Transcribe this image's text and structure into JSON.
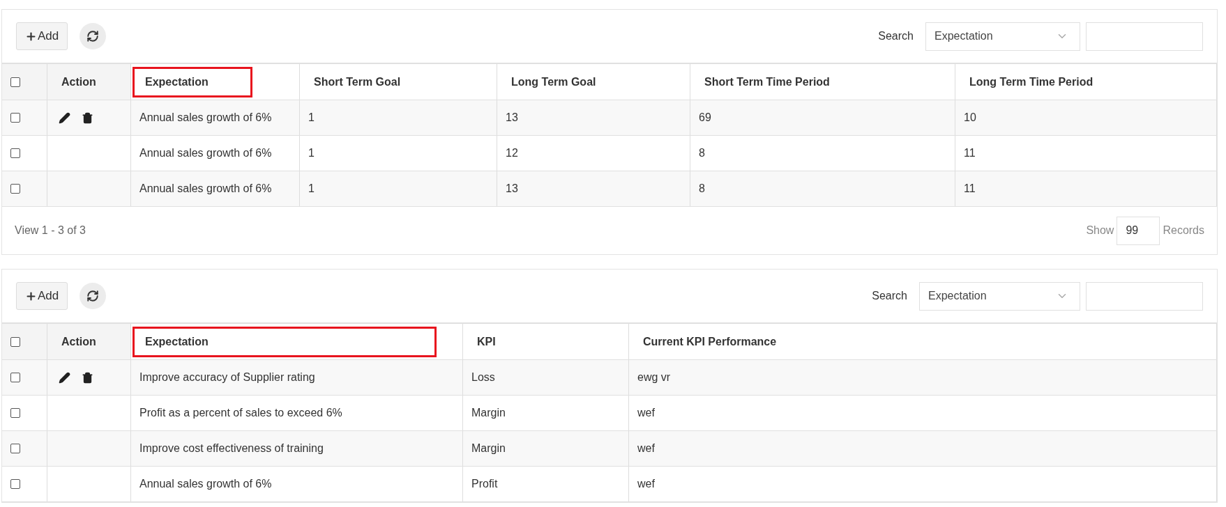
{
  "tables": [
    {
      "toolbar": {
        "add_label": "Add",
        "search_label": "Search",
        "search_field": "Expectation"
      },
      "select_all_checked": false,
      "action_label": "Action",
      "columns": [
        {
          "label": "Expectation",
          "highlighted": true
        },
        {
          "label": "Short Term Goal",
          "highlighted": false
        },
        {
          "label": "Long Term Goal",
          "highlighted": false
        },
        {
          "label": "Short Term Time Period",
          "highlighted": false
        },
        {
          "label": "Long Term Time Period",
          "highlighted": false
        }
      ],
      "rows": [
        {
          "checked": false,
          "actions": true,
          "cells": [
            "Annual sales growth of 6%",
            "1",
            "13",
            "69",
            "10"
          ]
        },
        {
          "checked": false,
          "actions": false,
          "cells": [
            "Annual sales growth of 6%",
            "1",
            "12",
            "8",
            "11"
          ]
        },
        {
          "checked": false,
          "actions": false,
          "cells": [
            "Annual sales growth of 6%",
            "1",
            "13",
            "8",
            "11"
          ]
        }
      ],
      "footer": {
        "view": "View 1 - 3 of 3",
        "show_label": "Show",
        "page_size": "99",
        "records_label": "Records"
      }
    },
    {
      "toolbar": {
        "add_label": "Add",
        "search_label": "Search",
        "search_field": "Expectation"
      },
      "select_all_checked": false,
      "action_label": "Action",
      "columns": [
        {
          "label": "Expectation",
          "highlighted": true
        },
        {
          "label": "KPI",
          "highlighted": false
        },
        {
          "label": "Current KPI Performance",
          "highlighted": false
        }
      ],
      "rows": [
        {
          "checked": false,
          "actions": true,
          "cells": [
            "Improve accuracy of Supplier rating",
            "Loss",
            "ewg vr"
          ]
        },
        {
          "checked": false,
          "actions": false,
          "cells": [
            "Profit as a percent of sales to exceed 6%",
            "Margin",
            "wef"
          ]
        },
        {
          "checked": false,
          "actions": false,
          "cells": [
            "Improve cost effectiveness of training",
            "Margin",
            "wef"
          ]
        },
        {
          "checked": false,
          "actions": false,
          "cells": [
            "Annual sales growth of 6%",
            "Profit",
            "wef"
          ]
        }
      ]
    }
  ]
}
